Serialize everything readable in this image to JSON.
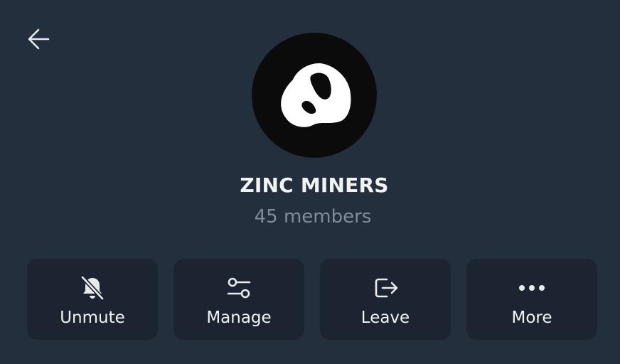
{
  "header": {
    "back_icon": "arrow-left-icon"
  },
  "profile": {
    "avatar_icon": "group-avatar-logo",
    "name": "ZINC MINERS",
    "members": "45 members"
  },
  "actions": [
    {
      "label": "Unmute",
      "icon": "bell-slash-icon"
    },
    {
      "label": "Manage",
      "icon": "sliders-icon"
    },
    {
      "label": "Leave",
      "icon": "logout-icon"
    },
    {
      "label": "More",
      "icon": "more-horizontal-icon"
    }
  ],
  "colors": {
    "background": "#242f3d",
    "button_bg": "#1b2430",
    "text_primary": "#f2f3f5",
    "text_secondary": "#7f8c9c",
    "avatar_bg": "#0b0b0c"
  }
}
